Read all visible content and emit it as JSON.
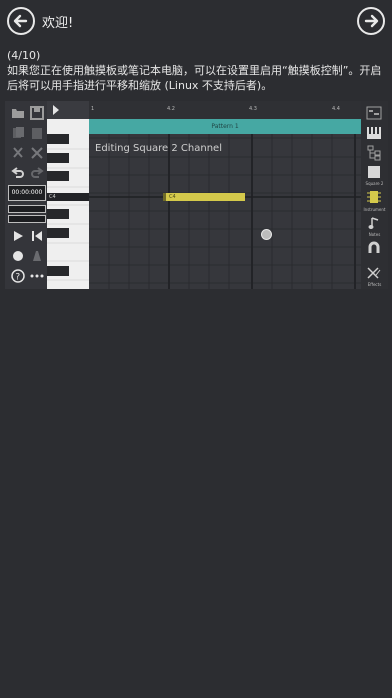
{
  "header": {
    "title": "欢迎!",
    "back_icon": "arrow-left-icon",
    "next_icon": "arrow-right-icon"
  },
  "tutorial": {
    "step": "(4/10)",
    "text": "如果您正在使用触摸板或笔记本电脑，可以在设置里启用“触摸板控制”。开启后将可以用手指进行平移和缩放 (Linux 不支持后者)。"
  },
  "editor": {
    "time": "00:00:000",
    "caption": "Editing Square 2 Channel",
    "pattern_label": "Pattern 1",
    "note_label": "C4",
    "row_label": "C4",
    "ruler": [
      "1",
      "4.2",
      "4.3",
      "4.4"
    ],
    "right_tools": [
      {
        "name": "sequencer-icon",
        "label": ""
      },
      {
        "name": "piano-icon",
        "label": ""
      },
      {
        "name": "hierarchy-icon",
        "label": ""
      },
      {
        "name": "square-icon",
        "label": "Square 2"
      },
      {
        "name": "chip-icon",
        "label": "Instrument"
      },
      {
        "name": "note-icon",
        "label": "Notes"
      },
      {
        "name": "magnet-icon",
        "label": ""
      },
      {
        "name": "effects-icon",
        "label": "Effects"
      }
    ]
  },
  "colors": {
    "background": "#2c2d31",
    "teal": "#46a8a3",
    "note": "#d4c94b"
  }
}
